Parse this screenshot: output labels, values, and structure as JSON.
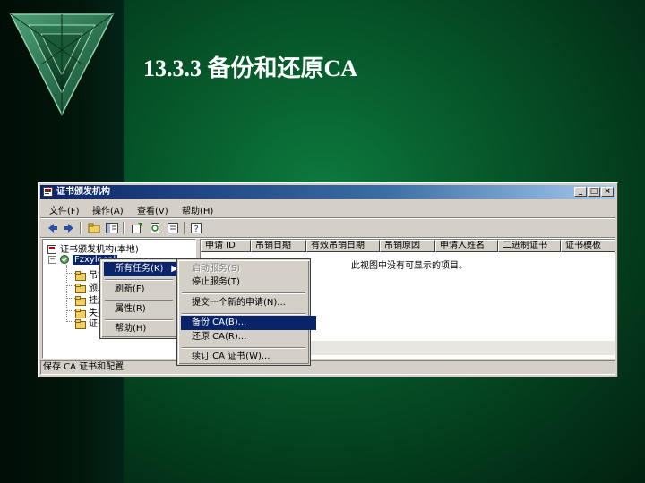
{
  "slide": {
    "title": "13.3.3  备份和还原CA"
  },
  "window": {
    "title": "证书颁发机构",
    "buttons": {
      "minimize": "_",
      "maximize": "□",
      "close": "×"
    },
    "menu": [
      "文件(F)",
      "操作(A)",
      "查看(V)",
      "帮助(H)"
    ],
    "tree": {
      "root": "证书颁发机构(本地)",
      "ca_node": "Fzxylocal",
      "children": [
        "吊销",
        "颁发",
        "挂起",
        "失败",
        "证书"
      ]
    },
    "columns": [
      "申请 ID",
      "吊销日期",
      "有效吊销日期",
      "吊销原因",
      "申请人姓名",
      "二进制证书",
      "证书模板"
    ],
    "empty_message": "此视图中没有可显示的项目。",
    "status_text": "保存 CA 证书和配置"
  },
  "context_menu": {
    "items": [
      {
        "label": "所有任务(K)",
        "submenu": true,
        "active": true
      },
      {
        "separator": true
      },
      {
        "label": "刷新(F)"
      },
      {
        "separator": true
      },
      {
        "label": "属性(R)"
      },
      {
        "separator": true
      },
      {
        "label": "帮助(H)"
      }
    ]
  },
  "submenu": {
    "items": [
      {
        "label": "启动服务(S)",
        "disabled": true
      },
      {
        "label": "停止服务(T)"
      },
      {
        "separator": true
      },
      {
        "label": "提交一个新的申请(N)..."
      },
      {
        "separator": true
      },
      {
        "label": "备份 CA(B)...",
        "active": true
      },
      {
        "label": "还原 CA(R)..."
      },
      {
        "separator": true
      },
      {
        "label": "续订 CA 证书(W)..."
      }
    ]
  },
  "colors": {
    "slide_bg": "#075a2c",
    "titlebar": "#0a246a",
    "highlight": "#0a246a",
    "window_face": "#d4d0c8"
  },
  "icons": [
    "triangle-emblem-icon",
    "app-icon",
    "back-icon",
    "forward-icon",
    "up-folder-icon",
    "console-tree-icon",
    "export-icon",
    "refresh-icon",
    "properties-icon",
    "help-icon",
    "ca-server-icon",
    "folder-icon",
    "submenu-arrow-icon"
  ]
}
